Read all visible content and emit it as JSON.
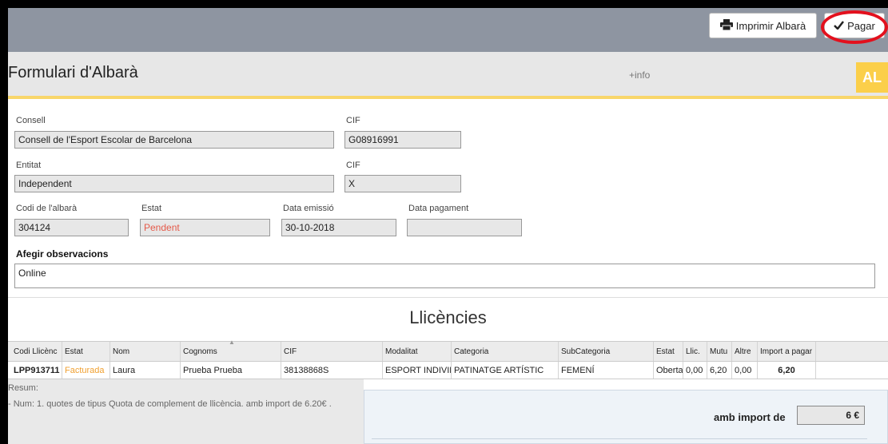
{
  "toolbar": {
    "print_icon": "printer-icon",
    "print_label": "Imprimir Albarà",
    "pay_icon": "check-icon",
    "pay_label": "Pagar",
    "highlight_color": "#e3101d"
  },
  "header": {
    "title": "Formulari d'Albarà",
    "info_link": "+info",
    "badge": "AL",
    "badge_color": "#fbcf4a"
  },
  "form": {
    "consell_label": "Consell",
    "consell_value": "Consell de l'Esport Escolar de Barcelona",
    "cif1_label": "CIF",
    "cif1_value": "G08916991",
    "entitat_label": "Entitat",
    "entitat_value": "Independent",
    "cif2_label": "CIF",
    "cif2_value": "X",
    "codi_label": "Codi de l'albarà",
    "codi_value": "304124",
    "estat_label": "Estat",
    "estat_value": "Pendent",
    "data_emissio_label": "Data emissió",
    "data_emissio_value": "30-10-2018",
    "data_pagament_label": "Data pagament",
    "data_pagament_value": "",
    "observations_label": "Afegir observacions",
    "observations_value": "Online"
  },
  "licences": {
    "title": "Llicències",
    "columns": [
      "Codi Llicènc",
      "Estat",
      "Nom",
      "Cognoms",
      "CIF",
      "Modalitat",
      "Categoria",
      "SubCategoria",
      "Estat",
      "Llic.",
      "Mutu",
      "Altre",
      "Import a pagar"
    ],
    "rows": [
      [
        "LPP913711",
        "Facturada",
        "Laura",
        "Prueba Prueba",
        "38138868S",
        "ESPORT INDIVIDUAL",
        "PATINATGE ARTÍSTIC",
        "FEMENÍ",
        "Oberta",
        "0,00",
        "6,20",
        "0,00",
        "6,20"
      ]
    ]
  },
  "summary": {
    "label": "Resum:",
    "text": "- Num: 1. quotes de tipus Quota de complement de llicència. amb import de 6.20€ .",
    "total_label": "amb import de",
    "total_value": "6 €"
  }
}
